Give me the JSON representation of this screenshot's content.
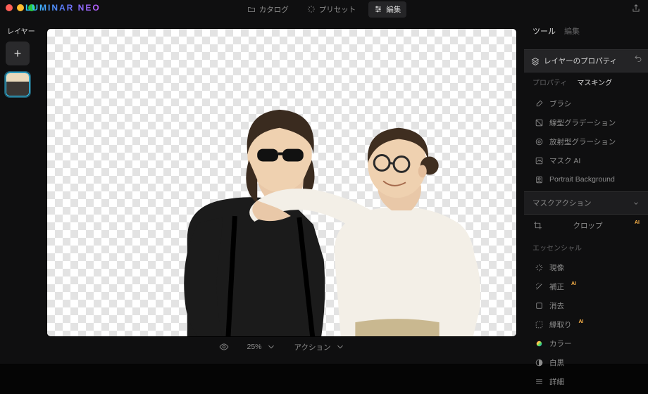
{
  "app": {
    "brand": "LUMINAR NEO"
  },
  "tabs": {
    "catalog": "カタログ",
    "presets": "プリセット",
    "edit": "編集"
  },
  "left": {
    "title": "レイヤー",
    "add": "+"
  },
  "status": {
    "zoom": "25% ",
    "action": "アクション "
  },
  "right": {
    "tab_tool": "ツール",
    "tab_edit": "編集",
    "panel_title": "レイヤーのプロパティ",
    "sub_props": "プロパティ",
    "sub_mask": "マスキング",
    "tools": {
      "brush": "ブラシ",
      "linear": "線型グラデーション",
      "radial": "放射型グラーション",
      "maskai": "マスク AI",
      "portrait": "Portrait Background"
    },
    "mask_action": "マスクアクション",
    "crop": "クロップ",
    "essentials": "エッセンシャル",
    "essential_tools": {
      "develop": "現像",
      "enhance": "補正",
      "erase": "消去",
      "clip": "縁取り",
      "color": "カラー",
      "bw": "白黒",
      "detail": "詳細"
    }
  }
}
